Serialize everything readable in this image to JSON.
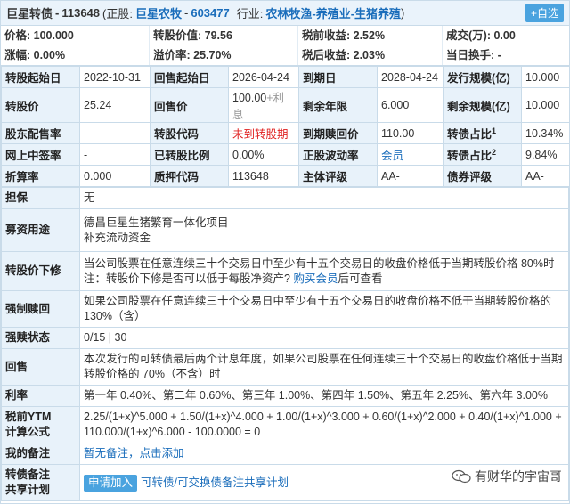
{
  "header": {
    "bond_name": "巨星转债",
    "bond_code": "113648",
    "stock_prefix": "(正股:",
    "stock_name": "巨星农牧",
    "stock_code": "603477",
    "industry_prefix": "行业:",
    "industry": "农林牧渔-养殖业-生猪养殖",
    "suffix": ")",
    "fav_button": "+自选"
  },
  "quote": {
    "price": "价格: 100.000",
    "conv_value": "转股价值: 79.56",
    "pretax_yield": "税前收益: 2.52%",
    "volume": "成交(万): 0.00",
    "change": "涨幅: 0.00%",
    "premium": "溢价率: 25.70%",
    "aftertax_yield": "税后收益: 2.03%",
    "turnover": "当日换手: -"
  },
  "grid": [
    [
      "转股起始日",
      "2022-10-31",
      "回售起始日",
      "2026-04-24",
      "到期日",
      "2028-04-24",
      "发行规模(亿)",
      "10.000"
    ],
    [
      "转股价",
      "25.24",
      "回售价",
      "100.00",
      "剩余年限",
      "6.000",
      "剩余规模(亿)",
      "10.000"
    ],
    [
      "股东配售率",
      "-",
      "转股代码",
      "未到转股期",
      "到期赎回价",
      "110.00",
      "转债占比",
      "10.34%"
    ],
    [
      "网上中签率",
      "-",
      "已转股比例",
      "0.00%",
      "正股波动率",
      "会员",
      "转债占比",
      "9.84%"
    ],
    [
      "折算率",
      "0.000",
      "质押代码",
      "113648",
      "主体评级",
      "AA-",
      "债券评级",
      "AA-"
    ]
  ],
  "put_price_suffix": "+利息",
  "sup1": "1",
  "sup2": "2",
  "info": {
    "guarantee_label": "担保",
    "guarantee": "无",
    "use_label": "募资用途",
    "use_line1": "德昌巨星生猪繁育一体化项目",
    "use_line2": "补充流动资金",
    "reset_label": "转股价下修",
    "reset_text": "当公司股票在任意连续三十个交易日中至少有十五个交易日的收盘价格低于当期转股价格 80%时 注：转股价下修是否可以低于每股净资产?",
    "reset_link": "购买会员",
    "reset_tail": "后可查看",
    "redeem_label": "强制赎回",
    "redeem_text": "如果公司股票在任意连续三十个交易日中至少有十五个交易日的收盘价格不低于当期转股价格的 130%（含）",
    "redeem_count_label": "强赎状态",
    "redeem_count": "0/15 | 30",
    "putback_label": "回售",
    "putback_text": "本次发行的可转债最后两个计息年度，如果公司股票在任何连续三十个交易日的收盘价格低于当期转股价格的 70%（不含）时",
    "rate_label": "利率",
    "rate_text": "第一年 0.40%、第二年 0.60%、第三年 1.00%、第四年 1.50%、第五年 2.25%、第六年 3.00%",
    "ytm_label_1": "税前YTM",
    "ytm_label_2": "计算公式",
    "ytm_text": "2.25/(1+x)^5.000 + 1.50/(1+x)^4.000 + 1.00/(1+x)^3.000 + 0.60/(1+x)^2.000 + 0.40/(1+x)^1.000 + 110.000/(1+x)^6.000 - 100.0000 = 0",
    "note_label": "我的备注",
    "note_text": "暂无备注，点击添加",
    "share_label_1": "转债备注",
    "share_label_2": "共享计划",
    "share_button": "申请加入",
    "share_text": "可转债/可交换债备注共享计划"
  },
  "watermark": "有财华的宇宙哥"
}
